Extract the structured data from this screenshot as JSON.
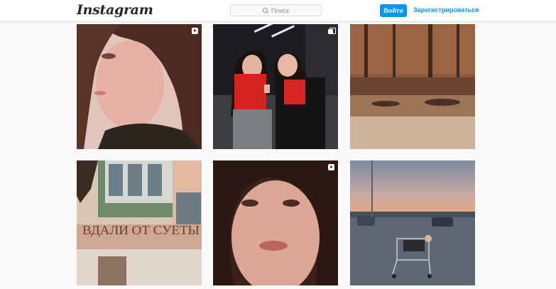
{
  "header": {
    "logo_text": "Instagram",
    "search_placeholder": "Поиск",
    "login_label": "Войти",
    "signup_label": "Зарегистрироваться"
  },
  "posts": [
    {
      "subject": "girl profile portrait",
      "badge": "video-icon"
    },
    {
      "subject": "two girls in red shirts",
      "badge": "carousel-icon"
    },
    {
      "subject": "autumn leaves on ground",
      "badge": ""
    },
    {
      "subject": "building with sign",
      "sign_text": "ВДАЛИ ОТ СУЕТЫ",
      "badge": ""
    },
    {
      "subject": "girl close-up face",
      "badge": "video-icon"
    },
    {
      "subject": "girl in shopping cart at sunset",
      "badge": ""
    }
  ],
  "colors": {
    "accent": "#0095f6",
    "background": "#fafafa",
    "border": "#dbdbdb"
  }
}
